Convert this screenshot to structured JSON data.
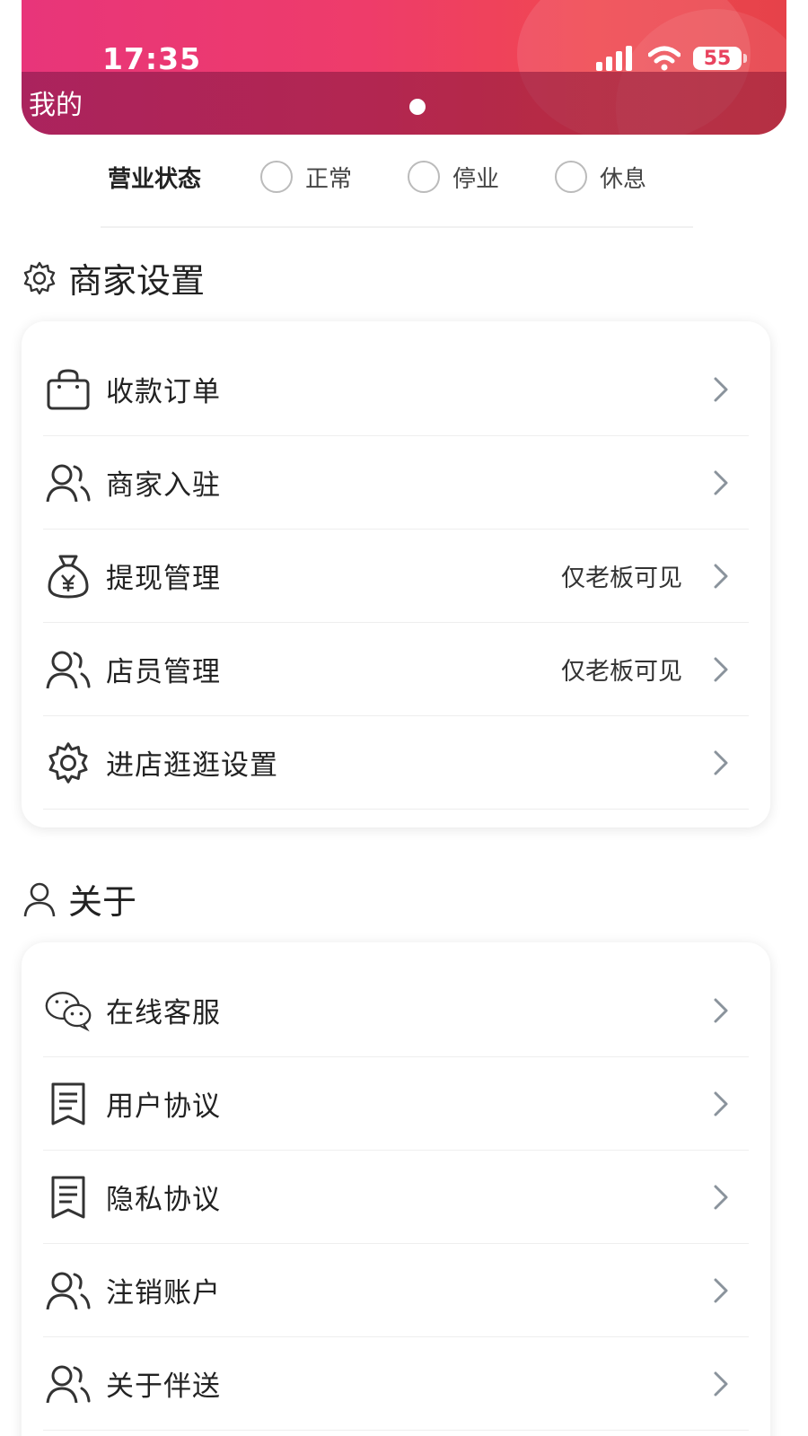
{
  "status_bar": {
    "time": "17:35",
    "battery": "55"
  },
  "header": {
    "title": "我的"
  },
  "business_status": {
    "label": "营业状态",
    "options": [
      "正常",
      "停业",
      "休息"
    ]
  },
  "merchant_settings": {
    "title": "商家设置",
    "items": [
      {
        "label": "收款订单",
        "icon": "shopping-bag-icon",
        "hint": ""
      },
      {
        "label": "商家入驻",
        "icon": "users-icon",
        "hint": ""
      },
      {
        "label": "提现管理",
        "icon": "money-bag-icon",
        "hint": "仅老板可见"
      },
      {
        "label": "店员管理",
        "icon": "users-icon",
        "hint": "仅老板可见"
      },
      {
        "label": "进店逛逛设置",
        "icon": "gear-icon",
        "hint": ""
      }
    ]
  },
  "about": {
    "title": "关于",
    "items": [
      {
        "label": "在线客服",
        "icon": "wechat-chat-icon"
      },
      {
        "label": "用户协议",
        "icon": "document-icon"
      },
      {
        "label": "隐私协议",
        "icon": "document-icon"
      },
      {
        "label": "注销账户",
        "icon": "users-icon"
      },
      {
        "label": "关于伴送",
        "icon": "users-icon"
      }
    ]
  },
  "colors": {
    "header_start": "#e8357a",
    "header_end": "#f0474f",
    "chevron": "#8a939c"
  }
}
